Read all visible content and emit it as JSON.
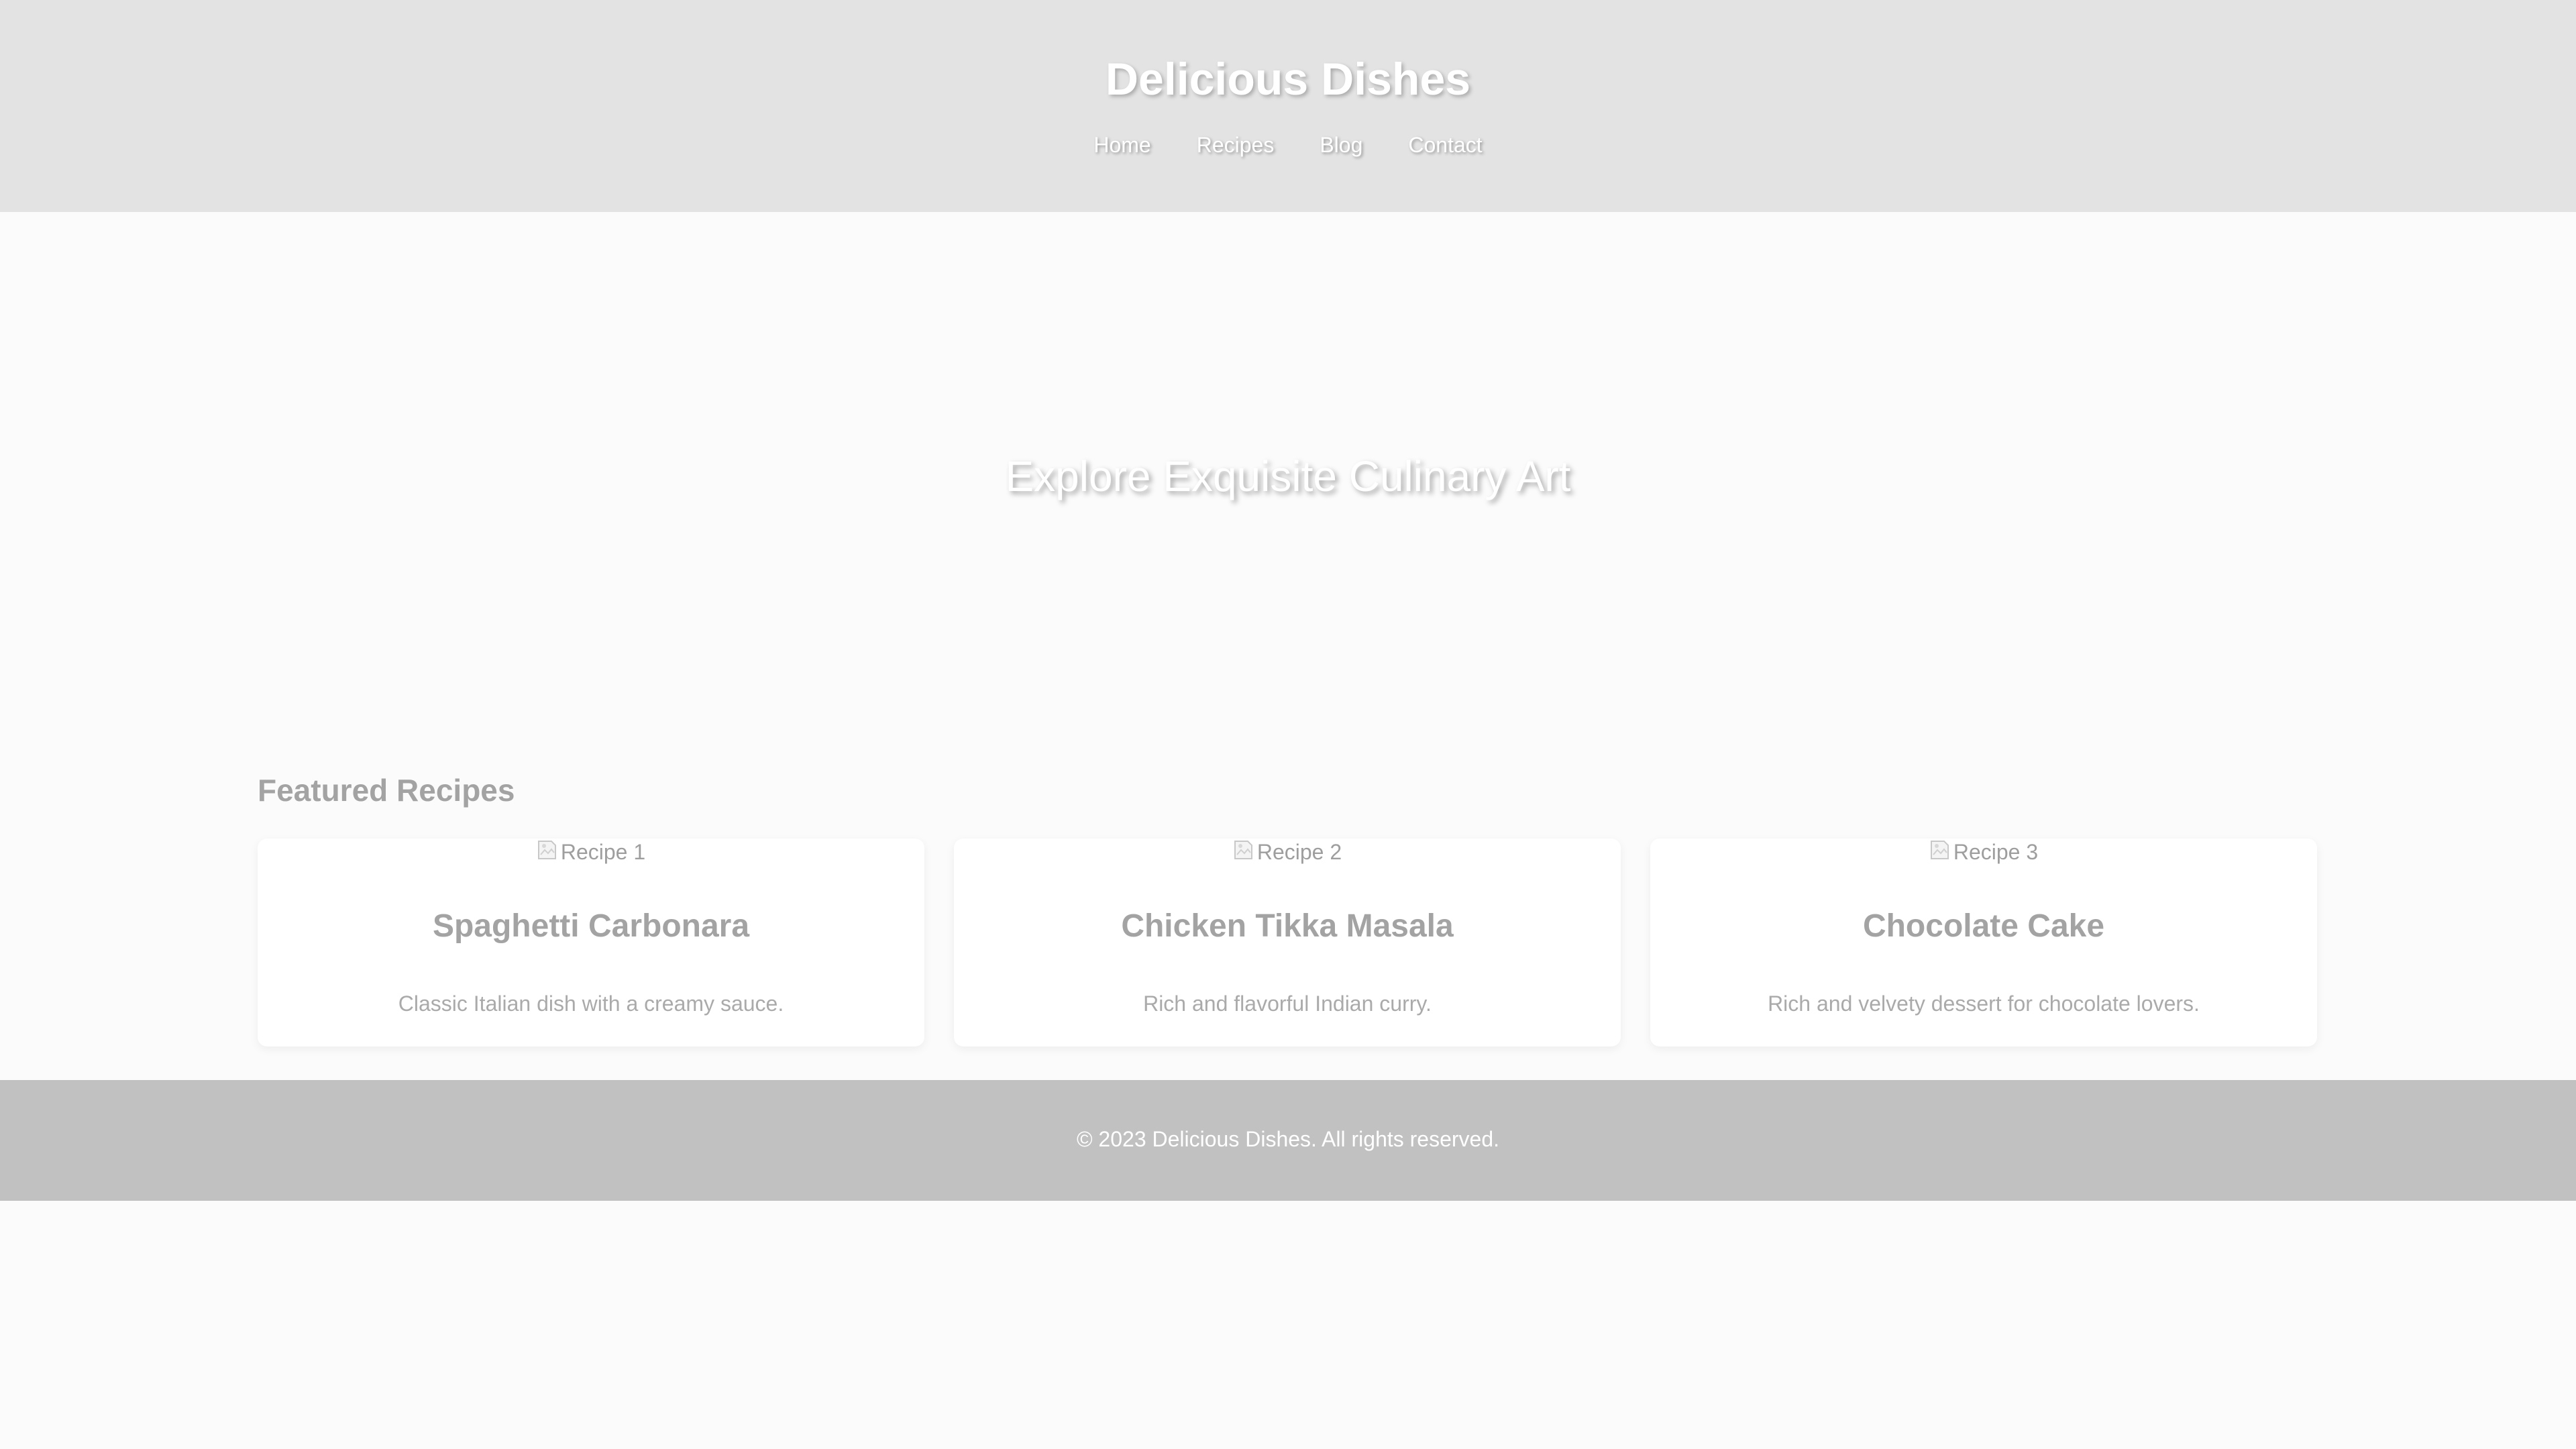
{
  "header": {
    "site_title": "Delicious Dishes",
    "nav": [
      "Home",
      "Recipes",
      "Blog",
      "Contact"
    ]
  },
  "hero": {
    "heading": "Explore Exquisite Culinary Art"
  },
  "featured": {
    "title": "Featured Recipes",
    "recipes": [
      {
        "image_alt": "Recipe 1",
        "title": "Spaghetti Carbonara",
        "description": "Classic Italian dish with a creamy sauce."
      },
      {
        "image_alt": "Recipe 2",
        "title": "Chicken Tikka Masala",
        "description": "Rich and flavorful Indian curry."
      },
      {
        "image_alt": "Recipe 3",
        "title": "Chocolate Cake",
        "description": "Rich and velvety dessert for chocolate lovers."
      }
    ]
  },
  "footer": {
    "text": "© 2023 Delicious Dishes. All rights reserved."
  },
  "colors": {
    "header_bg": "#e3e3e3",
    "footer_bg": "#c1c1c1",
    "page_bg": "#fbfbfb"
  }
}
